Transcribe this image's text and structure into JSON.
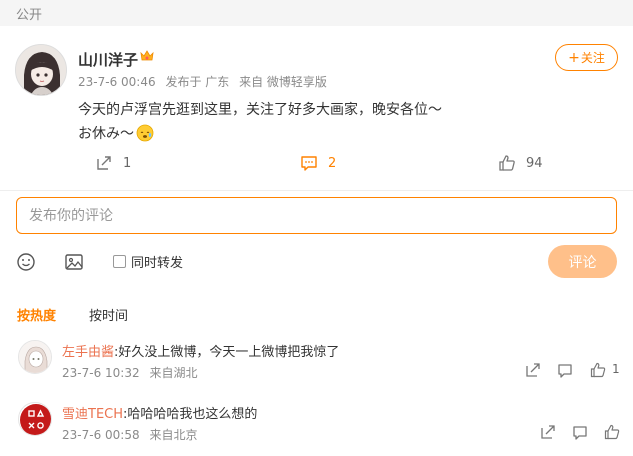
{
  "header": {
    "visibility": "公开"
  },
  "post": {
    "author": "山川洋子",
    "date": "23-7-6 00:46",
    "location": "发布于 广东",
    "source": "来自 微博轻享版",
    "follow_label": "关注",
    "content_line1": "今天的卢浮宫先逛到这里，关注了好多大画家，晚安各位～",
    "content_line2": "お休み～",
    "repost_count": "1",
    "comment_count": "2",
    "like_count": "94"
  },
  "composer": {
    "placeholder": "发布你的评论",
    "repost_option": "同时转发",
    "submit_label": "评论"
  },
  "sort": {
    "hot": "按热度",
    "time": "按时间"
  },
  "comments": [
    {
      "user": "左手由酱",
      "text": ":好久没上微博，今天一上微博把我惊了",
      "date": "23-7-6 10:32",
      "source": "来自湖北",
      "likes": "1"
    },
    {
      "user": "雪迪TECH",
      "text": ":哈哈哈哈我也这么想的",
      "date": "23-7-6 00:58",
      "source": "来自北京",
      "likes": ""
    }
  ],
  "colors": {
    "accent": "#ff8200",
    "username": "#eb7350",
    "submit_disabled": "#ffc08a"
  }
}
